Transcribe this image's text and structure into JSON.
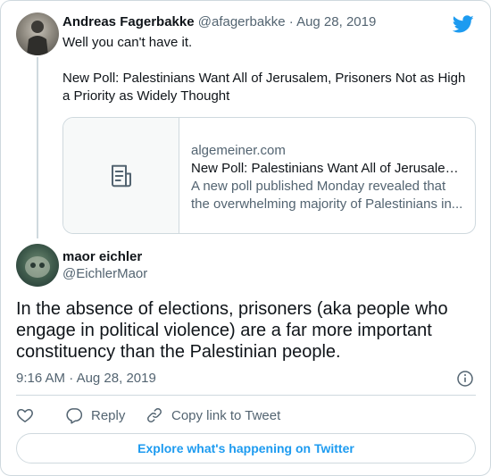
{
  "quoted_tweet": {
    "name": "Andreas Fagerbakke",
    "handle": "@afagerbakke",
    "date": "Aug 28, 2019",
    "line1": "Well you can't have it.",
    "line2": "New Poll: Palestinians Want All of Jerusalem, Prisoners Not as High a Priority as Widely Thought",
    "link_card": {
      "domain": "algemeiner.com",
      "title": "New Poll: Palestinians Want All of Jerusalem, Prisoners Not as High a Priority as Widely Thought",
      "description": "A new poll published Monday revealed that the overwhelming majority of Palestinians in..."
    }
  },
  "tweet": {
    "name": "maor eichler",
    "handle": "@EichlerMaor",
    "text": "In the absence of elections, prisoners (aka people who engage in political violence) are a far more important constituency than the Palestinian people.",
    "time": "9:16 AM",
    "date": "Aug 28, 2019"
  },
  "actions": {
    "reply": "Reply",
    "copy_link": "Copy link to Tweet"
  },
  "explore_label": "Explore what's happening on Twitter",
  "icons": [
    "twitter-logo-icon",
    "document-icon",
    "info-icon",
    "heart-icon",
    "reply-icon",
    "link-icon"
  ],
  "colors": {
    "accent": "#1d9bf0",
    "secondary_text": "#536471",
    "border": "#cfd9de"
  }
}
